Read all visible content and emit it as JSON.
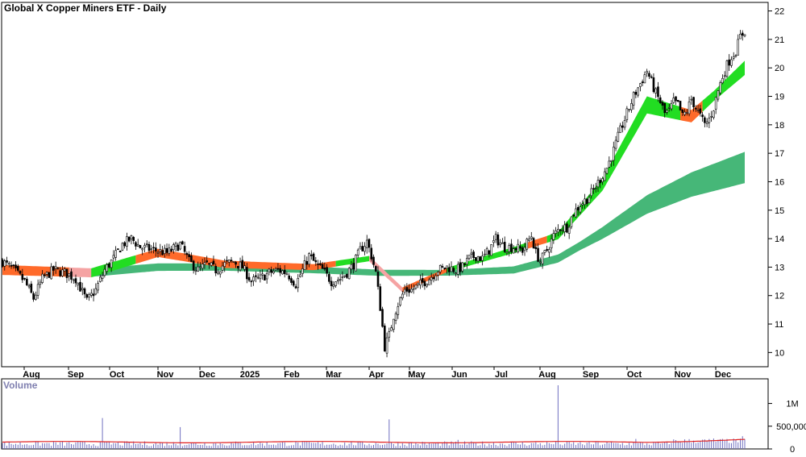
{
  "chart_data": [
    {
      "type": "candlestick",
      "title": "Global X Copper Miners ETF - Daily",
      "x_labels": [
        "Aug",
        "Sep",
        "Oct",
        "Nov",
        "Dec",
        "2025",
        "Feb",
        "Mar",
        "Apr",
        "May",
        "Jun",
        "Jul",
        "Aug",
        "Sep",
        "Oct",
        "Nov",
        "Dec"
      ],
      "y_ticks": [
        10,
        11,
        12,
        13,
        14,
        15,
        16,
        17,
        18,
        19,
        20,
        21,
        22
      ],
      "ylim": [
        9.5,
        22.3
      ],
      "price_anchors": [
        [
          0,
          13.2
        ],
        [
          5,
          12.9
        ],
        [
          10,
          12.5
        ],
        [
          14,
          11.9
        ],
        [
          18,
          12.6
        ],
        [
          23,
          12.9
        ],
        [
          28,
          12.8
        ],
        [
          33,
          12.6
        ],
        [
          38,
          11.8
        ],
        [
          42,
          12.2
        ],
        [
          46,
          12.9
        ],
        [
          50,
          13.3
        ],
        [
          54,
          13.8
        ],
        [
          58,
          14.0
        ],
        [
          62,
          13.7
        ],
        [
          68,
          13.6
        ],
        [
          74,
          13.5
        ],
        [
          80,
          13.8
        ],
        [
          84,
          13.2
        ],
        [
          88,
          12.9
        ],
        [
          92,
          13.1
        ],
        [
          96,
          12.9
        ],
        [
          100,
          13.1
        ],
        [
          104,
          13.2
        ],
        [
          108,
          13.0
        ],
        [
          112,
          12.5
        ],
        [
          116,
          12.6
        ],
        [
          120,
          12.8
        ],
        [
          124,
          12.9
        ],
        [
          128,
          12.8
        ],
        [
          132,
          12.4
        ],
        [
          135,
          12.9
        ],
        [
          138,
          13.4
        ],
        [
          141,
          13.1
        ],
        [
          144,
          12.9
        ],
        [
          148,
          12.5
        ],
        [
          152,
          12.6
        ],
        [
          155,
          12.8
        ],
        [
          158,
          13.1
        ],
        [
          161,
          13.6
        ],
        [
          164,
          13.9
        ],
        [
          166,
          13.4
        ],
        [
          168,
          12.8
        ],
        [
          170,
          11.6
        ],
        [
          172,
          10.2
        ],
        [
          174,
          10.6
        ],
        [
          176,
          11.3
        ],
        [
          178,
          11.7
        ],
        [
          181,
          12.2
        ],
        [
          184,
          12.2
        ],
        [
          188,
          12.4
        ],
        [
          192,
          12.6
        ],
        [
          196,
          12.9
        ],
        [
          200,
          13.0
        ],
        [
          204,
          12.9
        ],
        [
          207,
          13.0
        ],
        [
          210,
          13.3
        ],
        [
          213,
          13.4
        ],
        [
          216,
          13.3
        ],
        [
          219,
          13.6
        ],
        [
          222,
          14.0
        ],
        [
          226,
          13.7
        ],
        [
          230,
          13.7
        ],
        [
          234,
          13.6
        ],
        [
          238,
          14.1
        ],
        [
          240,
          13.5
        ],
        [
          242,
          13.2
        ],
        [
          245,
          13.6
        ],
        [
          248,
          14.1
        ],
        [
          251,
          14.4
        ],
        [
          254,
          14.4
        ],
        [
          257,
          14.9
        ],
        [
          260,
          15.2
        ],
        [
          263,
          15.4
        ],
        [
          266,
          15.7
        ],
        [
          269,
          16.1
        ],
        [
          272,
          16.5
        ],
        [
          275,
          17.1
        ],
        [
          278,
          17.8
        ],
        [
          280,
          18.2
        ],
        [
          282,
          18.6
        ],
        [
          284,
          19.0
        ],
        [
          286,
          19.3
        ],
        [
          288,
          19.6
        ],
        [
          290,
          19.9
        ],
        [
          292,
          19.5
        ],
        [
          294,
          19.1
        ],
        [
          296,
          18.8
        ],
        [
          298,
          18.4
        ],
        [
          300,
          18.5
        ],
        [
          302,
          18.8
        ],
        [
          304,
          18.7
        ],
        [
          306,
          18.3
        ],
        [
          308,
          18.5
        ],
        [
          310,
          18.9
        ],
        [
          312,
          18.6
        ],
        [
          314,
          18.3
        ],
        [
          316,
          18.0
        ],
        [
          318,
          18.2
        ],
        [
          320,
          18.6
        ],
        [
          322,
          19.2
        ],
        [
          324,
          19.7
        ],
        [
          326,
          20.1
        ],
        [
          328,
          20.4
        ],
        [
          330,
          20.6
        ],
        [
          332,
          21.1
        ],
        [
          334,
          21.3
        ]
      ],
      "ma_short": [
        [
          0,
          12.9
        ],
        [
          40,
          12.8
        ],
        [
          70,
          13.5
        ],
        [
          100,
          13.1
        ],
        [
          140,
          13.0
        ],
        [
          165,
          13.3
        ],
        [
          180,
          12.2
        ],
        [
          200,
          12.9
        ],
        [
          230,
          13.6
        ],
        [
          250,
          14.1
        ],
        [
          270,
          15.9
        ],
        [
          290,
          18.7
        ],
        [
          310,
          18.3
        ],
        [
          334,
          20.0
        ]
      ],
      "ma_short_offset": [
        [
          0,
          0.35
        ],
        [
          60,
          0.3
        ],
        [
          150,
          0.2
        ],
        [
          200,
          0.15
        ],
        [
          250,
          0.25
        ],
        [
          290,
          0.6
        ],
        [
          320,
          0.35
        ],
        [
          334,
          0.5
        ]
      ],
      "ma_long": [
        [
          0,
          12.9
        ],
        [
          40,
          12.8
        ],
        [
          70,
          13.0
        ],
        [
          100,
          13.0
        ],
        [
          140,
          12.9
        ],
        [
          170,
          12.8
        ],
        [
          200,
          12.8
        ],
        [
          230,
          12.9
        ],
        [
          250,
          13.3
        ],
        [
          270,
          14.2
        ],
        [
          290,
          15.2
        ],
        [
          310,
          15.9
        ],
        [
          334,
          16.5
        ]
      ],
      "ma_long_offset": [
        [
          0,
          0.3
        ],
        [
          100,
          0.25
        ],
        [
          200,
          0.2
        ],
        [
          260,
          0.3
        ],
        [
          290,
          0.65
        ],
        [
          334,
          1.1
        ]
      ]
    },
    {
      "type": "bar",
      "title": "Volume",
      "y_ticks": [
        "1M",
        "500,000",
        "0"
      ],
      "y_tick_values": [
        1000000,
        500000,
        0
      ],
      "ylim": [
        0,
        1400000
      ],
      "spikes": [
        [
          45,
          680000
        ],
        [
          80,
          480000
        ],
        [
          174,
          650000
        ],
        [
          205,
          200000
        ],
        [
          250,
          1400000
        ],
        [
          285,
          220000
        ],
        [
          320,
          230000
        ],
        [
          333,
          280000
        ]
      ],
      "ma_level": 150000
    }
  ]
}
